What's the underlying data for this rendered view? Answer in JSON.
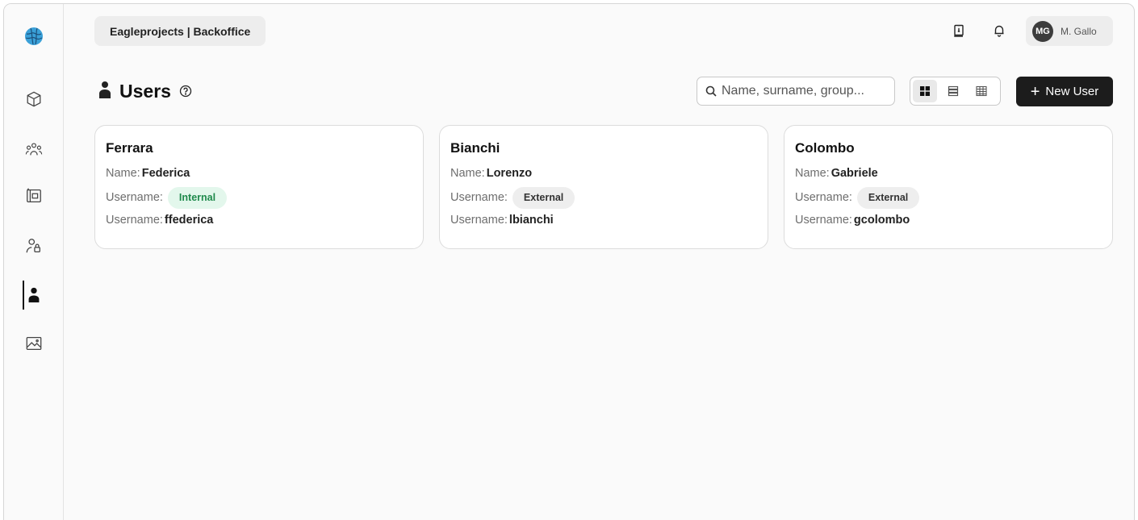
{
  "header": {
    "brand": "Eagleprojects | Backoffice",
    "user_initials": "MG",
    "user_name": "M. Gallo"
  },
  "page": {
    "title": "Users",
    "search_placeholder": "Name, surname, group...",
    "new_button_label": "New User"
  },
  "sidebar": {
    "items": [
      {
        "icon": "globe-logo-icon"
      },
      {
        "icon": "cube-icon"
      },
      {
        "icon": "group-icon"
      },
      {
        "icon": "board-icon"
      },
      {
        "icon": "user-lock-icon"
      },
      {
        "icon": "person-icon",
        "active": true
      },
      {
        "icon": "image-icon"
      }
    ]
  },
  "users": [
    {
      "surname": "Ferrara",
      "name_label": "Name:",
      "name": "Federica",
      "type_label": "Username:",
      "type": "Internal",
      "username_label": "Username:",
      "username": "ffederica"
    },
    {
      "surname": "Bianchi",
      "name_label": "Name:",
      "name": "Lorenzo",
      "type_label": "Username:",
      "type": "External",
      "username_label": "Username:",
      "username": "lbianchi"
    },
    {
      "surname": "Colombo",
      "name_label": "Name:",
      "name": "Gabriele",
      "type_label": "Username:",
      "type": "External",
      "username_label": "Username:",
      "username": "gcolombo"
    }
  ],
  "colors": {
    "accent": "#1c1c1c",
    "internal_badge_bg": "#e3f7ec",
    "internal_badge_text": "#1f8a4c",
    "external_badge_bg": "#eeeeee"
  }
}
